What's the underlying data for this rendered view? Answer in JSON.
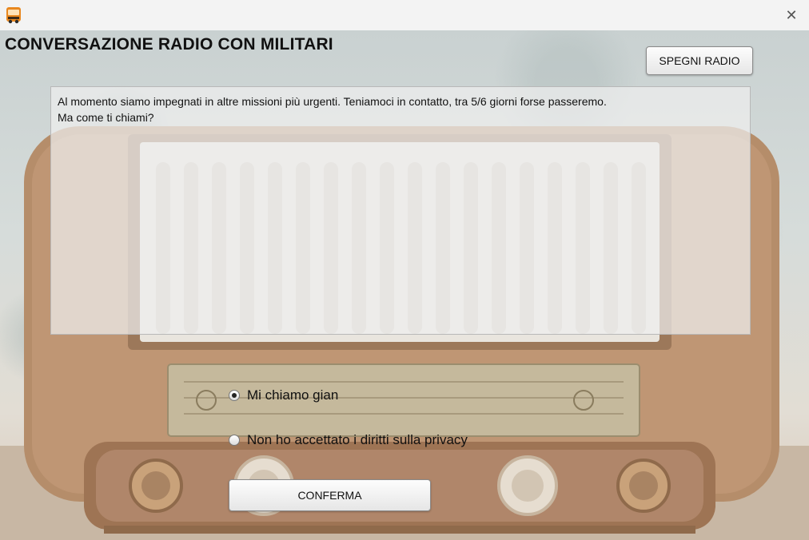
{
  "window": {
    "close_glyph": "✕",
    "app_icon": "bus-icon"
  },
  "page_title": "CONVERSAZIONE RADIO CON MILITARI",
  "buttons": {
    "turn_off_radio": "SPEGNI RADIO",
    "confirm": "CONFERMA"
  },
  "message": {
    "line1": "Al momento siamo impegnati in altre missioni più urgenti. Teniamoci in contatto, tra 5/6 giorni forse passeremo.",
    "line2": "Ma come ti chiami?"
  },
  "options": [
    {
      "label": "Mi chiamo gian",
      "selected": true
    },
    {
      "label": "Non ho accettato i diritti sulla privacy",
      "selected": false
    }
  ],
  "colors": {
    "wood": "#b58d6a",
    "wood_dark": "#8f6a4b",
    "grille": "#e7e3dc",
    "dial_panel": "#c5b99c",
    "knob": "#c9a27a"
  }
}
